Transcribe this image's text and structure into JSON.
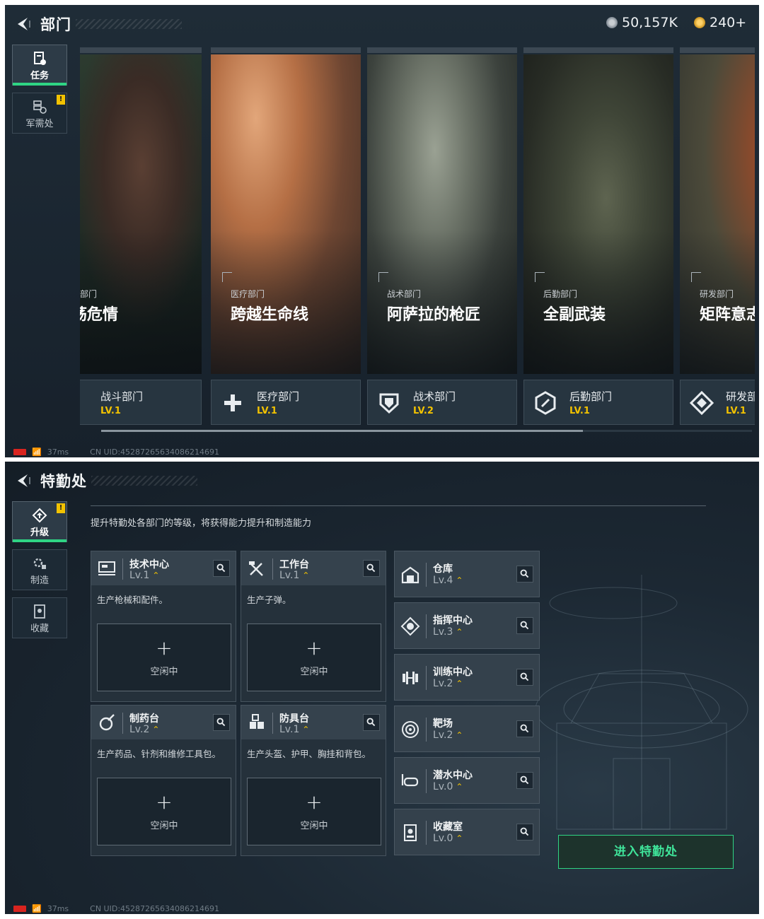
{
  "status_bar": {
    "latency": "37ms",
    "uid": "CN UID:452872656340862146​91"
  },
  "departments_screen": {
    "title": "部门",
    "currency_1": "50,157K",
    "currency_2": "240+",
    "side_tabs": [
      {
        "label": "任务",
        "icon": "task-icon"
      },
      {
        "label": "军需处",
        "icon": "supply-icon",
        "badge": "!"
      }
    ],
    "cards": [
      {
        "subtitle": "斗部门",
        "title": "震荡危情",
        "name": "战斗部门",
        "level": "LV.1",
        "icon": "combat-icon"
      },
      {
        "subtitle": "医疗部门",
        "title": "跨越生命线",
        "name": "医疗部门",
        "level": "LV.1",
        "icon": "medical-cross-icon"
      },
      {
        "subtitle": "战术部门",
        "title": "阿萨拉的枪匠",
        "name": "战术部门",
        "level": "LV.2",
        "icon": "tactical-shield-icon"
      },
      {
        "subtitle": "后勤部门",
        "title": "全副武装",
        "name": "后勤部门",
        "level": "LV.1",
        "icon": "logistics-hex-icon"
      },
      {
        "subtitle": "研发部门",
        "title": "矩阵意志",
        "name": "研发部",
        "level": "LV.1",
        "icon": "research-diamond-icon"
      }
    ],
    "scroll_position": 0.74
  },
  "special_ops_screen": {
    "title": "特勤处",
    "description": "提升特勤处各部门的等级，将获得能力提升和制造能力",
    "side_tabs": [
      {
        "label": "升级",
        "icon": "upgrade-icon",
        "badge": "!"
      },
      {
        "label": "制造",
        "icon": "craft-gear-icon"
      },
      {
        "label": "收藏",
        "icon": "collection-icon"
      }
    ],
    "facilities": [
      {
        "name": "技术中心",
        "level": "Lv.1",
        "desc": "生产枪械和配件。",
        "status": "空闲中",
        "icon": "tech-center-icon"
      },
      {
        "name": "工作台",
        "level": "Lv.1",
        "desc": "生产子弹。",
        "status": "空闲中",
        "icon": "workbench-tools-icon"
      },
      {
        "name": "制药台",
        "level": "Lv.2",
        "desc": "生产药品、针剂和维修工具包。",
        "status": "空闲中",
        "icon": "pharmacy-icon"
      },
      {
        "name": "防具台",
        "level": "Lv.1",
        "desc": "生产头盔、护甲、胸挂和背包。",
        "status": "空闲中",
        "icon": "armor-bench-icon"
      }
    ],
    "plus_glyph": "+",
    "rooms": [
      {
        "name": "仓库",
        "level": "Lv.4",
        "icon": "warehouse-icon"
      },
      {
        "name": "指挥中心",
        "level": "Lv.3",
        "icon": "command-center-icon"
      },
      {
        "name": "训练中心",
        "level": "Lv.2",
        "icon": "dumbbell-icon"
      },
      {
        "name": "靶场",
        "level": "Lv.2",
        "icon": "target-icon"
      },
      {
        "name": "潜水中心",
        "level": "Lv.0",
        "icon": "dive-mask-icon"
      },
      {
        "name": "收藏室",
        "level": "Lv.0",
        "icon": "collection-room-icon"
      }
    ],
    "enter_button": "进入特勤处"
  },
  "colors": {
    "accent_green": "#2fd484",
    "level_gold": "#f2c200",
    "alert_red": "#d9241f"
  }
}
